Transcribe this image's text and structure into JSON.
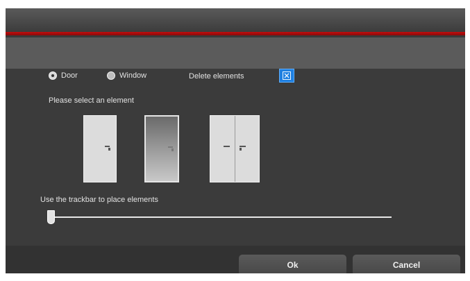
{
  "options": {
    "door_label": "Door",
    "window_label": "Window",
    "selected": "Door"
  },
  "delete": {
    "label": "Delete elements",
    "icon": "delete-x-icon"
  },
  "select_label": "Please select an element",
  "elements": [
    {
      "name": "single-door",
      "icon": "single-door-icon"
    },
    {
      "name": "window",
      "icon": "window-icon"
    },
    {
      "name": "double-door",
      "icon": "double-door-icon"
    }
  ],
  "trackbar": {
    "label": "Use the trackbar to place elements",
    "value": 0
  },
  "buttons": {
    "ok": "Ok",
    "cancel": "Cancel"
  },
  "colors": {
    "accent": "#c20d0d",
    "delete_button": "#1e7fe0"
  }
}
